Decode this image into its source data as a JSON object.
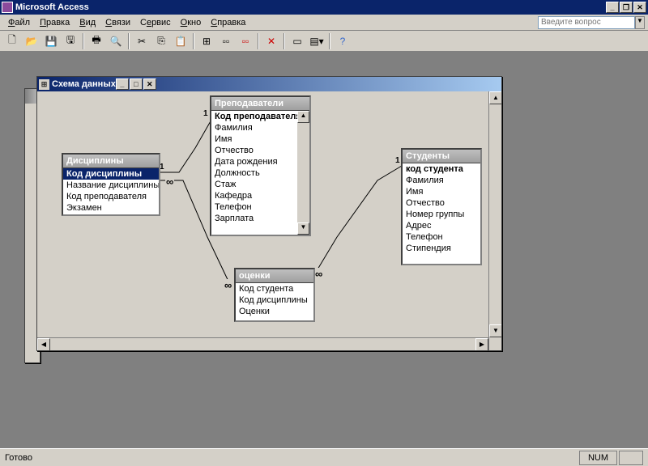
{
  "app": {
    "title": "Microsoft Access"
  },
  "menu": {
    "file": "Файл",
    "edit": "Правка",
    "view": "Вид",
    "relations": "Связи",
    "service": "Сервис",
    "window": "Окно",
    "help": "Справка",
    "question_placeholder": "Введите вопрос"
  },
  "child": {
    "title": "Схема данных"
  },
  "tables": {
    "t1": {
      "name": "Дисциплины",
      "fields": [
        "Код дисциплины",
        "Название дисциплины",
        "Код преподавателя",
        "Экзамен"
      ]
    },
    "t2": {
      "name": "Преподаватели",
      "fields": [
        "Код преподавателя",
        "Фамилия",
        "Имя",
        "Отчество",
        "Дата рождения",
        "Должность",
        "Стаж",
        "Кафедра",
        "Телефон",
        "Зарплата"
      ]
    },
    "t3": {
      "name": "оценки",
      "fields": [
        "Код студента",
        "Код дисциплины",
        "Оценки"
      ]
    },
    "t4": {
      "name": "Студенты",
      "fields": [
        "код студента",
        "Фамилия",
        "Имя",
        "Отчество",
        "Номер группы",
        "Адрес",
        "Телефон",
        "Стипендия"
      ]
    }
  },
  "rel": {
    "one": "1",
    "many": "∞"
  },
  "status": {
    "ready": "Готово",
    "num": "NUM"
  }
}
